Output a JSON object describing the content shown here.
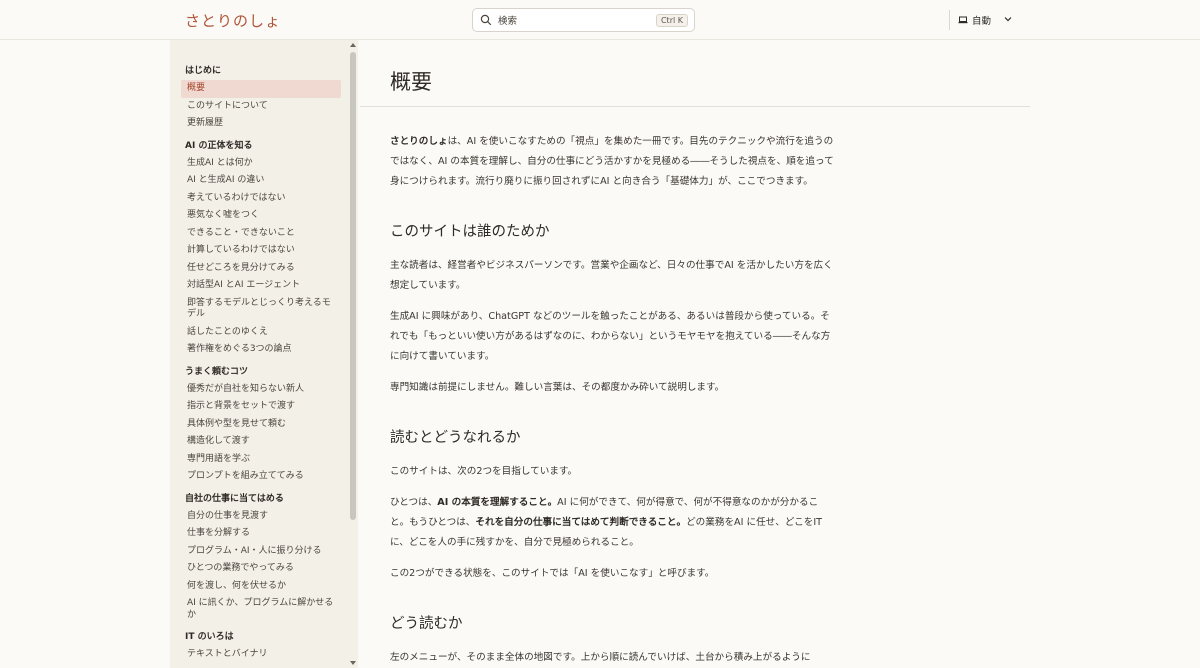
{
  "header": {
    "site_title": "さとりのしょ",
    "search_placeholder": "検索",
    "search_shortcut": "Ctrl K",
    "theme_label": "自動"
  },
  "sidebar": {
    "groups": [
      {
        "title": "はじめに",
        "items": [
          "概要",
          "このサイトについて",
          "更新履歴"
        ],
        "active": 0
      },
      {
        "title": "AI の正体を知る",
        "items": [
          "生成AI とは何か",
          "AI と生成AI の違い",
          "考えているわけではない",
          "悪気なく嘘をつく",
          "できること・できないこと",
          "計算しているわけではない",
          "任せどころを見分けてみる",
          "対話型AI とAI エージェント",
          "即答するモデルとじっくり考えるモデル",
          "話したことのゆくえ",
          "著作権をめぐる3つの論点"
        ]
      },
      {
        "title": "うまく頼むコツ",
        "items": [
          "優秀だが自社を知らない新人",
          "指示と背景をセットで渡す",
          "具体例や型を見せて頼む",
          "構造化して渡す",
          "専門用語を学ぶ",
          "プロンプトを組み立ててみる"
        ]
      },
      {
        "title": "自社の仕事に当てはめる",
        "items": [
          "自分の仕事を見渡す",
          "仕事を分解する",
          "プログラム・AI・人に振り分ける",
          "ひとつの業務でやってみる",
          "何を渡し、何を伏せるか",
          "AI に訊くか、プログラムに解かせるか"
        ]
      },
      {
        "title": "IT のいろは",
        "items": [
          "テキストとバイナリ"
        ]
      }
    ]
  },
  "main": {
    "title": "概要",
    "intro": {
      "bold": "さとりのしょ",
      "rest": "は、AI を使いこなすための「視点」を集めた一冊です。目先のテクニックや流行を追うのではなく、AI の本質を理解し、自分の仕事にどう活かすかを見極める――そうした視点を、順を追って身につけられます。流行り廃りに振り回されずにAI と向き合う「基礎体力」が、ここでつきます。"
    },
    "section1": {
      "heading": "このサイトは誰のためか",
      "p1": "主な読者は、経営者やビジネスパーソンです。営業や企画など、日々の仕事でAI を活かしたい方を広く想定しています。",
      "p2": "生成AI に興味があり、ChatGPT などのツールを触ったことがある、あるいは普段から使っている。それでも「もっといい使い方があるはずなのに、わからない」というモヤモヤを抱えている――そんな方に向けて書いています。",
      "p3": "専門知識は前提にしません。難しい言葉は、その都度かみ砕いて説明します。"
    },
    "section2": {
      "heading": "読むとどうなれるか",
      "p1": "このサイトは、次の2つを目指しています。",
      "p2_a": "ひとつは、",
      "p2_b": "AI の本質を理解すること。",
      "p2_c": "AI に何ができて、何が得意で、何が不得意なのかが分かること。もうひとつは、",
      "p2_d": "それを自分の仕事に当てはめて判断できること。",
      "p2_e": "どの業務をAI に任せ、どこをIT に、どこを人の手に残すかを、自分で見極められること。",
      "p3": "この2つができる状態を、このサイトでは「AI を使いこなす」と呼びます。"
    },
    "section3": {
      "heading": "どう読むか",
      "p1": "左のメニューが、そのまま全体の地図です。上から順に読んでいけば、土台から積み上がるように"
    }
  },
  "colors": {
    "accent": "#b0553a",
    "active_bg": "#efd9d0",
    "background": "#fbfaf6",
    "sidebar_bg": "#f3f0e8"
  }
}
